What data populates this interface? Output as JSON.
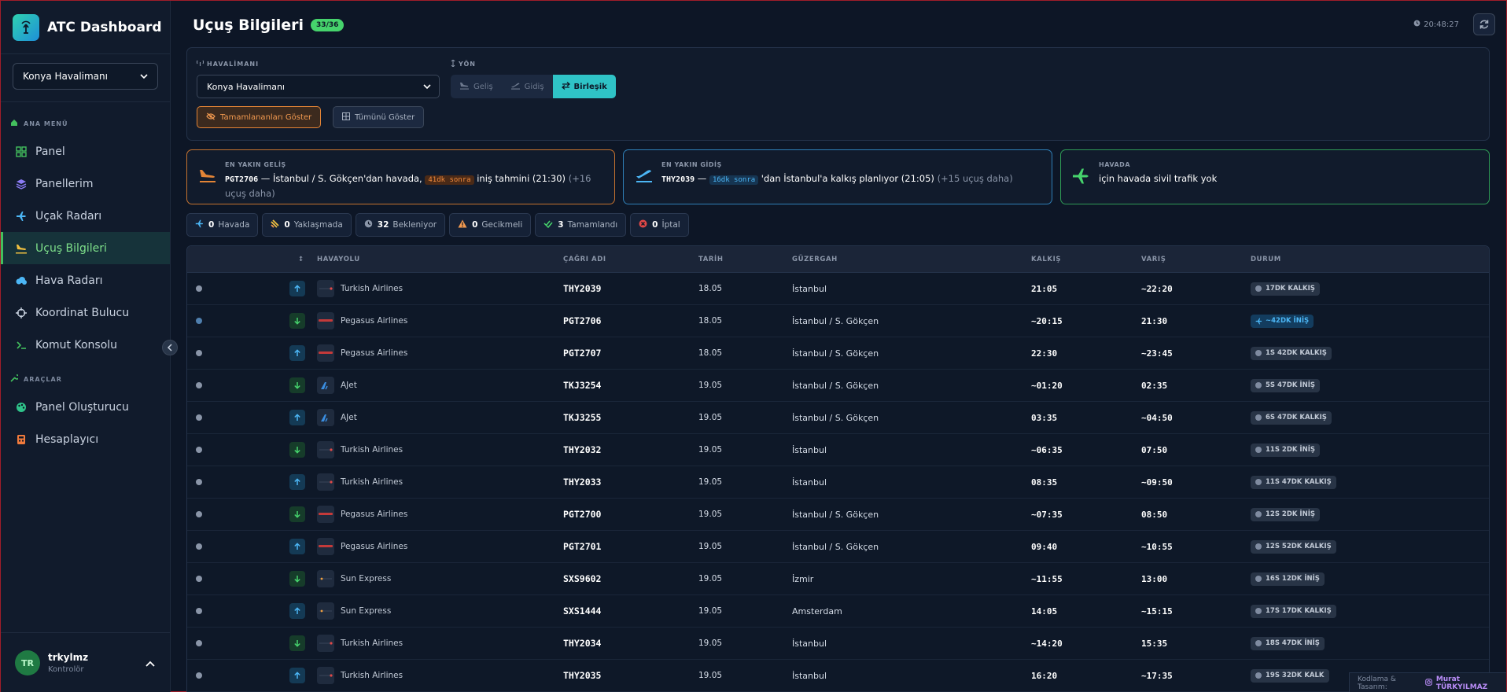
{
  "app": {
    "title": "ATC Dashboard"
  },
  "sidebar": {
    "airport_select": "Konya Havalimanı",
    "main_menu_label": "ANA MENÜ",
    "main_items": [
      {
        "label": "Panel",
        "icon": "grid-icon"
      },
      {
        "label": "Panellerim",
        "icon": "layers-icon"
      },
      {
        "label": "Uçak Radarı",
        "icon": "plane-icon"
      },
      {
        "label": "Uçuş Bilgileri",
        "icon": "plane-landing-icon",
        "active": true
      },
      {
        "label": "Hava Radarı",
        "icon": "cloud-icon"
      },
      {
        "label": "Koordinat Bulucu",
        "icon": "crosshair-icon"
      },
      {
        "label": "Komut Konsolu",
        "icon": "terminal-icon"
      }
    ],
    "tools_label": "ARAÇLAR",
    "tool_items": [
      {
        "label": "Panel Oluşturucu",
        "icon": "palette-icon"
      },
      {
        "label": "Hesaplayıcı",
        "icon": "calculator-icon"
      }
    ],
    "user": {
      "initials": "TR",
      "name": "trkylmz",
      "role": "Kontrolör"
    }
  },
  "header": {
    "title": "Uçuş Bilgileri",
    "count": "33/36",
    "clock": "20:48:27"
  },
  "filters": {
    "airport_label": "HAVALİMANI",
    "airport_value": "Konya Havalimanı",
    "direction_label": "YÖN",
    "direction_options": [
      "Geliş",
      "Gidiş",
      "Birleşik"
    ],
    "direction_selected": "Birleşik",
    "show_completed": "Tamamlananları Göster",
    "show_all": "Tümünü Göster"
  },
  "cards": {
    "arrival": {
      "label": "EN YAKIN GELİŞ",
      "code": "PGT2706",
      "text_a": " — İstanbul / S. Gökçen'dan havada, ",
      "tag": "41dk sonra",
      "text_b": " iniş tahmini (21:30) ",
      "more": "(+16 uçuş daha)"
    },
    "departure": {
      "label": "EN YAKIN GİDİŞ",
      "code": "THY2039",
      "text_a": " — ",
      "tag": "16dk sonra",
      "text_b": " 'dan İstanbul'a kalkış planlıyor (21:05) ",
      "more": "(+15 uçuş daha)"
    },
    "airborne": {
      "label": "HAVADA",
      "text": "için havada sivil trafik yok"
    }
  },
  "stats": [
    {
      "num": "0",
      "label": "Havada",
      "icon": "plane-icon"
    },
    {
      "num": "0",
      "label": "Yaklaşmada",
      "icon": "approach-icon"
    },
    {
      "num": "32",
      "label": "Bekleniyor",
      "icon": "clock-icon"
    },
    {
      "num": "0",
      "label": "Gecikmeli",
      "icon": "warning-icon"
    },
    {
      "num": "3",
      "label": "Tamamlandı",
      "icon": "check-icon"
    },
    {
      "num": "0",
      "label": "İptal",
      "icon": "cancel-icon"
    }
  ],
  "table": {
    "headers": [
      "",
      "↕",
      "HAVAYOLU",
      "ÇAĞRI ADI",
      "TARİH",
      "GÜZERGAH",
      "KALKIŞ",
      "VARIŞ",
      "DURUM"
    ],
    "rows": [
      {
        "dir": "up",
        "airline": "Turkish Airlines",
        "call": "THY2039",
        "date": "18.05",
        "route": "İstanbul",
        "dep": "21:05",
        "arr": "~22:20",
        "status": "17DK KALKIŞ"
      },
      {
        "dir": "down",
        "airline": "Pegasus Airlines",
        "call": "PGT2706",
        "date": "18.05",
        "route": "İstanbul / S. Gökçen",
        "dep": "~20:15",
        "arr": "21:30",
        "status": "~42DK İNİŞ",
        "airborne": true
      },
      {
        "dir": "up",
        "airline": "Pegasus Airlines",
        "call": "PGT2707",
        "date": "18.05",
        "route": "İstanbul / S. Gökçen",
        "dep": "22:30",
        "arr": "~23:45",
        "status": "1S 42DK KALKIŞ"
      },
      {
        "dir": "down",
        "airline": "AJet",
        "call": "TKJ3254",
        "date": "19.05",
        "route": "İstanbul / S. Gökçen",
        "dep": "~01:20",
        "arr": "02:35",
        "status": "5S 47DK İNİŞ"
      },
      {
        "dir": "up",
        "airline": "AJet",
        "call": "TKJ3255",
        "date": "19.05",
        "route": "İstanbul / S. Gökçen",
        "dep": "03:35",
        "arr": "~04:50",
        "status": "6S 47DK KALKIŞ"
      },
      {
        "dir": "down",
        "airline": "Turkish Airlines",
        "call": "THY2032",
        "date": "19.05",
        "route": "İstanbul",
        "dep": "~06:35",
        "arr": "07:50",
        "status": "11S 2DK İNİŞ"
      },
      {
        "dir": "up",
        "airline": "Turkish Airlines",
        "call": "THY2033",
        "date": "19.05",
        "route": "İstanbul",
        "dep": "08:35",
        "arr": "~09:50",
        "status": "11S 47DK KALKIŞ"
      },
      {
        "dir": "down",
        "airline": "Pegasus Airlines",
        "call": "PGT2700",
        "date": "19.05",
        "route": "İstanbul / S. Gökçen",
        "dep": "~07:35",
        "arr": "08:50",
        "status": "12S 2DK İNİŞ"
      },
      {
        "dir": "up",
        "airline": "Pegasus Airlines",
        "call": "PGT2701",
        "date": "19.05",
        "route": "İstanbul / S. Gökçen",
        "dep": "09:40",
        "arr": "~10:55",
        "status": "12S 52DK KALKIŞ"
      },
      {
        "dir": "down",
        "airline": "Sun Express",
        "call": "SXS9602",
        "date": "19.05",
        "route": "İzmir",
        "dep": "~11:55",
        "arr": "13:00",
        "status": "16S 12DK İNİŞ"
      },
      {
        "dir": "up",
        "airline": "Sun Express",
        "call": "SXS1444",
        "date": "19.05",
        "route": "Amsterdam",
        "dep": "14:05",
        "arr": "~15:15",
        "status": "17S 17DK KALKIŞ"
      },
      {
        "dir": "down",
        "airline": "Turkish Airlines",
        "call": "THY2034",
        "date": "19.05",
        "route": "İstanbul",
        "dep": "~14:20",
        "arr": "15:35",
        "status": "18S 47DK İNİŞ"
      },
      {
        "dir": "up",
        "airline": "Turkish Airlines",
        "call": "THY2035",
        "date": "19.05",
        "route": "İstanbul",
        "dep": "16:20",
        "arr": "~17:35",
        "status": "19S 32DK KALK"
      }
    ]
  },
  "credits": {
    "text": "Kodlama & Tasarım:",
    "author": "Murat TÜRKYILMAZ"
  },
  "colors": {
    "accent": "#2fc3c6",
    "active_green": "#43c05e",
    "arrival": "#e38436",
    "departure": "#4cb6f5",
    "airborne": "#46d36c"
  }
}
